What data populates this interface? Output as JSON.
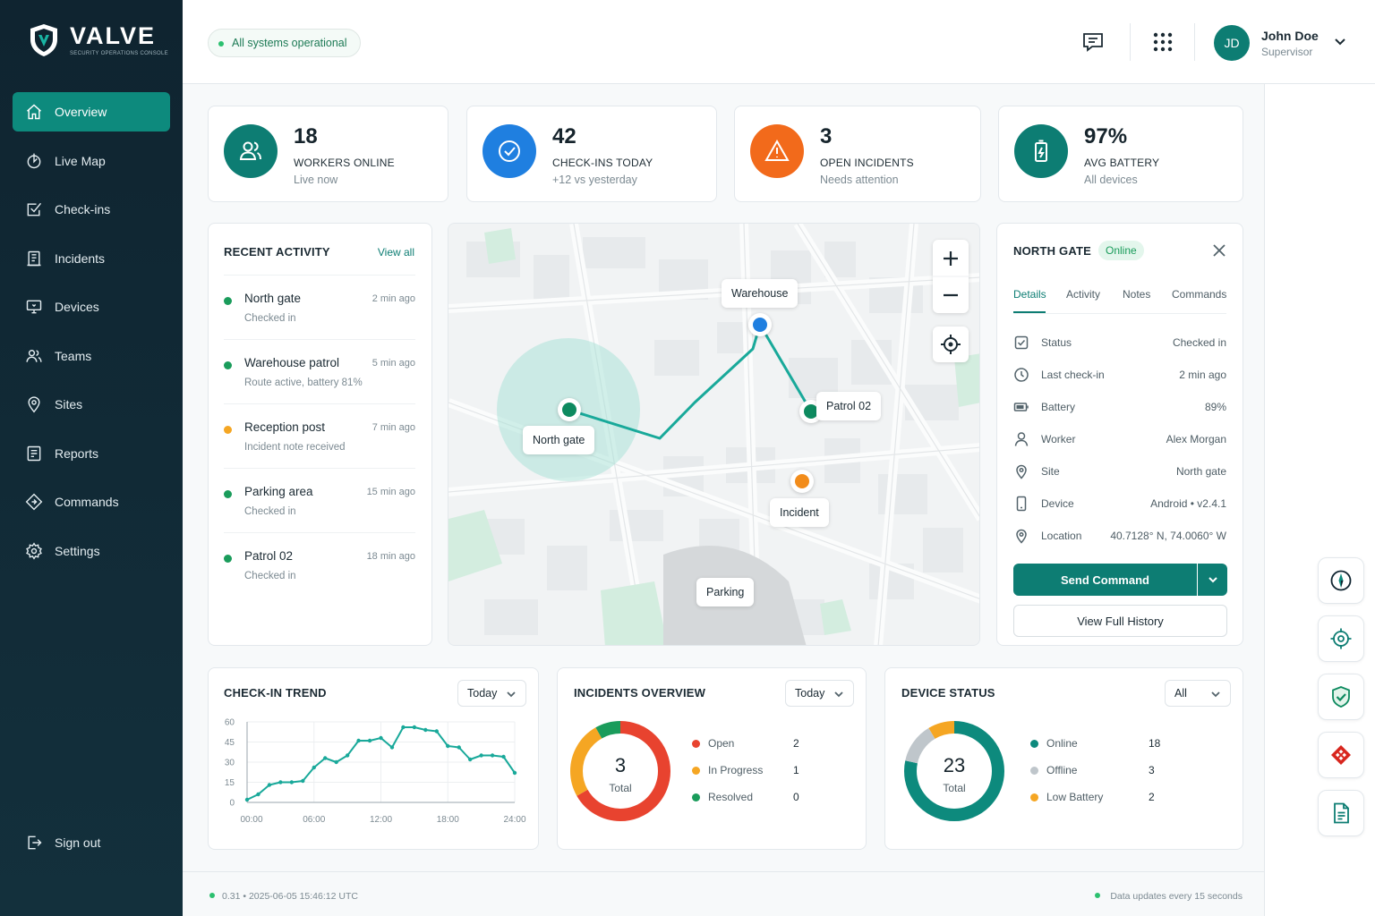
{
  "brand": {
    "name": "VALVE",
    "tagline": "SECURITY OPERATIONS CONSOLE"
  },
  "sidebar": {
    "items": [
      {
        "label": "Overview",
        "icon": "home-icon",
        "active": true
      },
      {
        "label": "Live Map",
        "icon": "live-map-icon"
      },
      {
        "label": "Check-ins",
        "icon": "checkin-icon"
      },
      {
        "label": "Incidents",
        "icon": "incident-icon"
      },
      {
        "label": "Devices",
        "icon": "device-icon"
      },
      {
        "label": "Teams",
        "icon": "teams-icon"
      },
      {
        "label": "Sites",
        "icon": "pin-icon"
      },
      {
        "label": "Reports",
        "icon": "report-icon"
      },
      {
        "label": "Commands",
        "icon": "command-icon"
      },
      {
        "label": "Settings",
        "icon": "gear-icon"
      }
    ],
    "signout": "Sign out"
  },
  "header": {
    "status": "All systems operational",
    "user": {
      "initials": "JD",
      "name": "John Doe",
      "role": "Supervisor"
    }
  },
  "stats": [
    {
      "value": "18",
      "label": "WORKERS ONLINE",
      "sub": "Live now",
      "color": "#0d7d73",
      "icon": "users-icon"
    },
    {
      "value": "42",
      "label": "CHECK-INS TODAY",
      "sub": "+12 vs yesterday",
      "color": "#1f7fe0",
      "icon": "check-circle-icon"
    },
    {
      "value": "3",
      "label": "OPEN INCIDENTS",
      "sub": "Needs attention",
      "color": "#f26a1b",
      "icon": "warning-icon"
    },
    {
      "value": "97%",
      "label": "AVG BATTERY",
      "sub": "All devices",
      "color": "#0d7d73",
      "icon": "battery-icon"
    }
  ],
  "activity": {
    "title": "RECENT ACTIVITY",
    "view_all": "View all",
    "items": [
      {
        "title": "North gate",
        "sub": "Checked in",
        "time": "2 min ago",
        "color": "#1a9c5b"
      },
      {
        "title": "Warehouse patrol",
        "sub": "Route active, battery 81%",
        "time": "5 min ago",
        "color": "#1a9c5b"
      },
      {
        "title": "Reception post",
        "sub": "Incident note received",
        "time": "7 min ago",
        "color": "#f5a623"
      },
      {
        "title": "Parking area",
        "sub": "Checked in",
        "time": "15 min ago",
        "color": "#1a9c5b"
      },
      {
        "title": "Patrol 02",
        "sub": "Checked in",
        "time": "18 min ago",
        "color": "#1a9c5b"
      }
    ]
  },
  "map": {
    "labels": {
      "warehouse": "Warehouse",
      "north_gate": "North gate",
      "patrol": "Patrol 02",
      "incident": "Incident",
      "parking": "Parking"
    }
  },
  "detail": {
    "title": "NORTH GATE",
    "status": "Online",
    "tabs": [
      "Details",
      "Activity",
      "Notes",
      "Commands"
    ],
    "rows": [
      {
        "key": "Status",
        "value": "Checked in",
        "icon": "check-square-icon"
      },
      {
        "key": "Last check-in",
        "value": "2 min ago",
        "icon": "clock-icon"
      },
      {
        "key": "Battery",
        "value": "89%",
        "icon": "battery-icon"
      },
      {
        "key": "Worker",
        "value": "Alex Morgan",
        "icon": "user-icon"
      },
      {
        "key": "Site",
        "value": "North gate",
        "icon": "pin-icon"
      },
      {
        "key": "Device",
        "value": "Android • v2.4.1",
        "icon": "phone-icon"
      },
      {
        "key": "Location",
        "value": "40.7128° N, 74.0060° W",
        "icon": "location-icon"
      }
    ],
    "send_command": "Send Command",
    "view_history": "View Full History"
  },
  "trend": {
    "title": "CHECK-IN TREND",
    "filter": "Today"
  },
  "incidents": {
    "title": "INCIDENTS OVERVIEW",
    "filter": "Today",
    "total": "3",
    "total_label": "Total",
    "legend": [
      {
        "name": "Open",
        "value": "2",
        "color": "#e8432f"
      },
      {
        "name": "In Progress",
        "value": "1",
        "color": "#f5a623"
      },
      {
        "name": "Resolved",
        "value": "0",
        "color": "#1a9c5b"
      }
    ]
  },
  "devices": {
    "title": "DEVICE STATUS",
    "filter": "All",
    "total": "23",
    "total_label": "Total",
    "legend": [
      {
        "name": "Online",
        "value": "18",
        "color": "#0d8a7d"
      },
      {
        "name": "Offline",
        "value": "3",
        "color": "#bfc6cb"
      },
      {
        "name": "Low Battery",
        "value": "2",
        "color": "#f5a623"
      }
    ]
  },
  "chart_data": {
    "type": "line",
    "title": "CHECK-IN TREND",
    "x_ticks": [
      "00:00",
      "06:00",
      "12:00",
      "18:00",
      "24:00"
    ],
    "y_ticks": [
      0,
      15,
      30,
      45,
      60
    ],
    "ylim": [
      0,
      60
    ],
    "xlim": [
      0,
      24
    ],
    "x": [
      0,
      1,
      2,
      3,
      4,
      5,
      6,
      7,
      8,
      9,
      10,
      11,
      12,
      13,
      14,
      15,
      16,
      17,
      18,
      19,
      20,
      21,
      22,
      23,
      24
    ],
    "values": [
      2,
      6,
      13,
      15,
      15,
      16,
      26,
      33,
      30,
      35,
      46,
      46,
      48,
      41,
      56,
      56,
      54,
      53,
      42,
      41,
      32,
      35,
      35,
      34,
      22
    ],
    "color": "#19a99a",
    "grid": true
  },
  "footer": {
    "left": "0.31 • 2025-06-05 15:46:12 UTC",
    "right": "Data updates every 15 seconds"
  },
  "colors": {
    "accent": "#0d7d73",
    "sidebar": "#0f2430"
  }
}
